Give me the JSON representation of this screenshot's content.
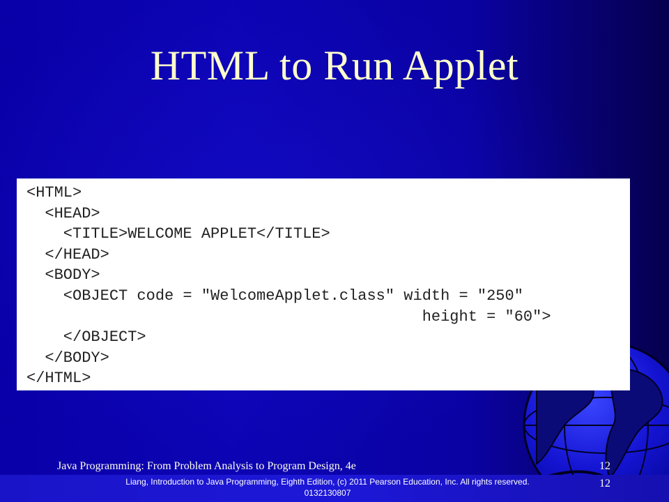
{
  "slide": {
    "title": "HTML to Run Applet",
    "code_lines": [
      "<HTML>",
      "  <HEAD>",
      "    <TITLE>WELCOME APPLET</TITLE>",
      "  </HEAD>",
      "  <BODY>",
      "    <OBJECT code = \"WelcomeApplet.class\" width = \"250\"",
      "                                           height = \"60\">",
      "    </OBJECT>",
      "  </BODY>",
      "</HTML>"
    ]
  },
  "footer": {
    "book": "Java Programming: From Problem Analysis to Program Design, 4e",
    "copyright": "Liang, Introduction to Java Programming, Eighth Edition, (c) 2011 Pearson Education, Inc. All rights reserved. 0132130807",
    "page_number_top": "12",
    "page_number_bottom": "12"
  },
  "colors": {
    "background": "#0a00a8",
    "title": "#ffffcc",
    "code_panel": "#ffffff",
    "code_text": "#222222"
  },
  "icons": {
    "background_decoration": "globe-icon"
  }
}
